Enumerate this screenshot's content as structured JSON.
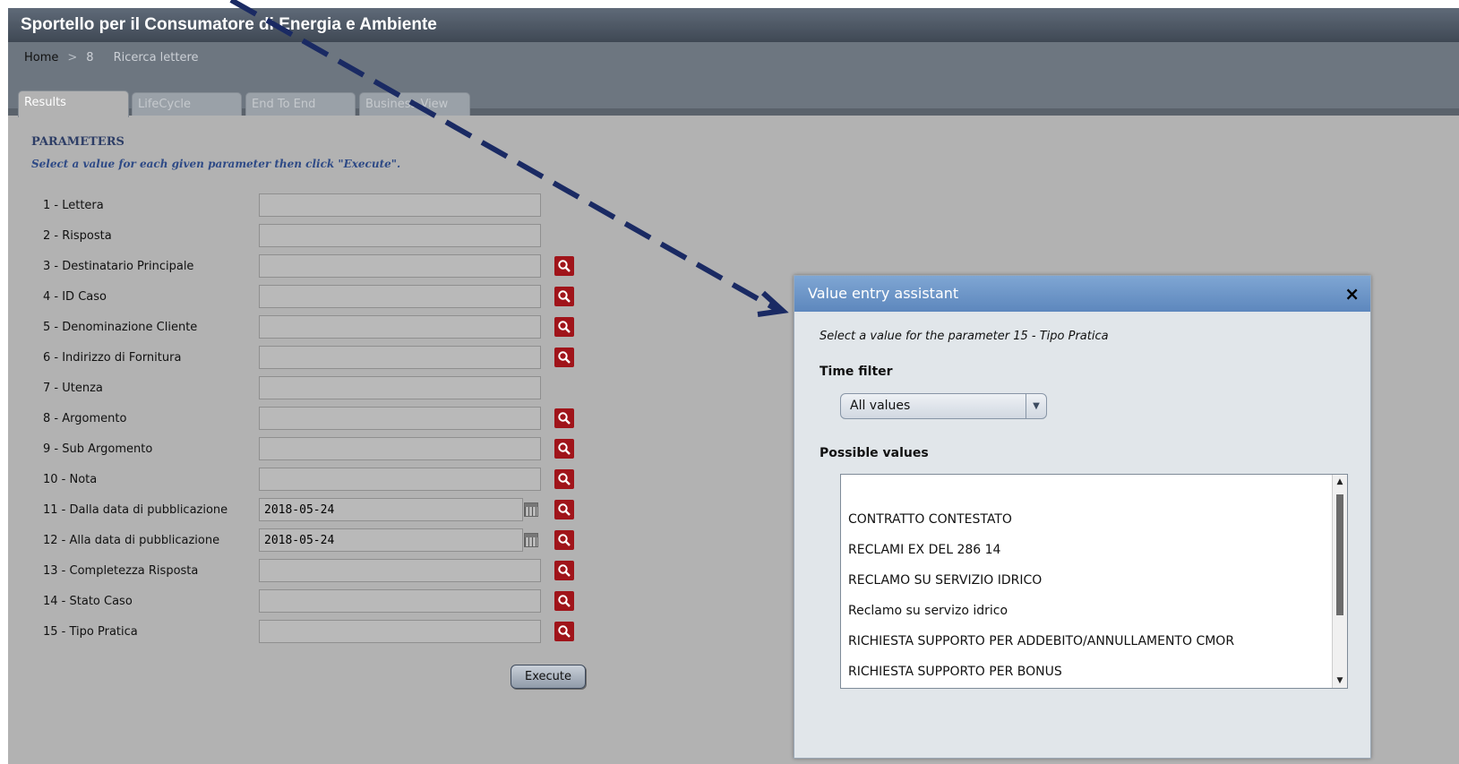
{
  "app": {
    "title": "Sportello per il Consumatore di Energia e Ambiente"
  },
  "breadcrumb": {
    "home": "Home",
    "sep1": ">",
    "item1": "8",
    "item2": "Ricerca lettere"
  },
  "tabs": [
    {
      "label": "Results"
    },
    {
      "label": "LifeCycle"
    },
    {
      "label": "End To End"
    },
    {
      "label": "Business View"
    }
  ],
  "params": {
    "title": "PARAMETERS",
    "hint": "Select a value for each given parameter then click \"Execute\".",
    "rows": [
      {
        "label": "1 - Lettera",
        "value": ""
      },
      {
        "label": "2 - Risposta",
        "value": ""
      },
      {
        "label": "3 - Destinatario Principale",
        "value": ""
      },
      {
        "label": "4 - ID Caso",
        "value": ""
      },
      {
        "label": "5 - Denominazione Cliente",
        "value": ""
      },
      {
        "label": "6 - Indirizzo di Fornitura",
        "value": ""
      },
      {
        "label": "7 - Utenza",
        "value": ""
      },
      {
        "label": "8 - Argomento",
        "value": ""
      },
      {
        "label": "9 - Sub Argomento",
        "value": ""
      },
      {
        "label": "10 - Nota",
        "value": ""
      },
      {
        "label": "11 - Dalla data di pubblicazione",
        "value": "2018-05-24"
      },
      {
        "label": "12 - Alla data di pubblicazione",
        "value": "2018-05-24"
      },
      {
        "label": "13 - Completezza Risposta",
        "value": ""
      },
      {
        "label": "14 - Stato Caso",
        "value": ""
      },
      {
        "label": "15 - Tipo Pratica",
        "value": ""
      }
    ],
    "execute_label": "Execute"
  },
  "dialog": {
    "title": "Value entry assistant",
    "close": "×",
    "hint": "Select a value for the parameter 15 - Tipo Pratica",
    "time_filter_label": "Time filter",
    "time_filter_value": "All values",
    "possible_values_label": "Possible values",
    "values": [
      "CONTRATTO CONTESTATO",
      "RECLAMI EX DEL 286 14",
      "RECLAMO SU SERVIZIO IDRICO",
      "Reclamo su servizo idrico",
      "RICHIESTA SUPPORTO PER ADDEBITO/ANNULLAMENTO CMOR",
      "RICHIESTA SUPPORTO PER BONUS"
    ]
  },
  "colors": {
    "accent_red": "#a0141a",
    "dialog_header": "#6a93c6",
    "annotation_arrow": "#1a2a63"
  }
}
